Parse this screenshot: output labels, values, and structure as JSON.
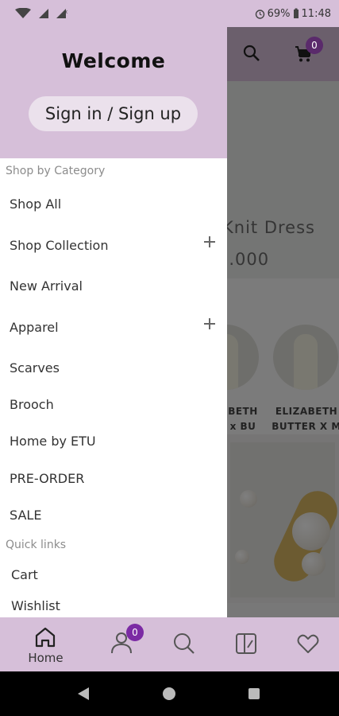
{
  "status_bar": {
    "battery": "69%",
    "time": "11:48",
    "icons": [
      "signal-icon",
      "wifi-icon",
      "alarm-icon",
      "battery-icon"
    ]
  },
  "drawer": {
    "welcome": "Welcome",
    "signin_label": "Sign in / Sign up",
    "category_title": "Shop by Category",
    "categories": [
      {
        "label": "Shop All",
        "expandable": false
      },
      {
        "label": "Shop Collection",
        "expandable": true
      },
      {
        "label": "New Arrival",
        "expandable": false
      },
      {
        "label": "Apparel",
        "expandable": true
      },
      {
        "label": "Scarves",
        "expandable": false
      },
      {
        "label": "Brooch",
        "expandable": false
      },
      {
        "label": "Home by ETU",
        "expandable": false
      },
      {
        "label": "PRE-ORDER",
        "expandable": false
      },
      {
        "label": "SALE",
        "expandable": false
      }
    ],
    "quick_links_title": "Quick links",
    "quick_links": [
      "Cart",
      "Wishlist"
    ]
  },
  "background_page": {
    "hero_title": "Knit Dress",
    "hero_price": "0.000",
    "cart_count": "0",
    "collections": [
      {
        "line1": "BETH",
        "line2": "x BU"
      },
      {
        "line1": "ELIZABETH",
        "line2": "BUTTER X M"
      }
    ]
  },
  "bottom_nav": {
    "home_label": "Home",
    "account_badge": "0",
    "items": [
      "home-icon",
      "account-icon",
      "search-icon",
      "catalog-icon",
      "wishlist-icon"
    ]
  },
  "colors": {
    "brand": "#d6bfd9",
    "badge": "#7b2aa4",
    "signin_bg": "#ebe1ec"
  }
}
